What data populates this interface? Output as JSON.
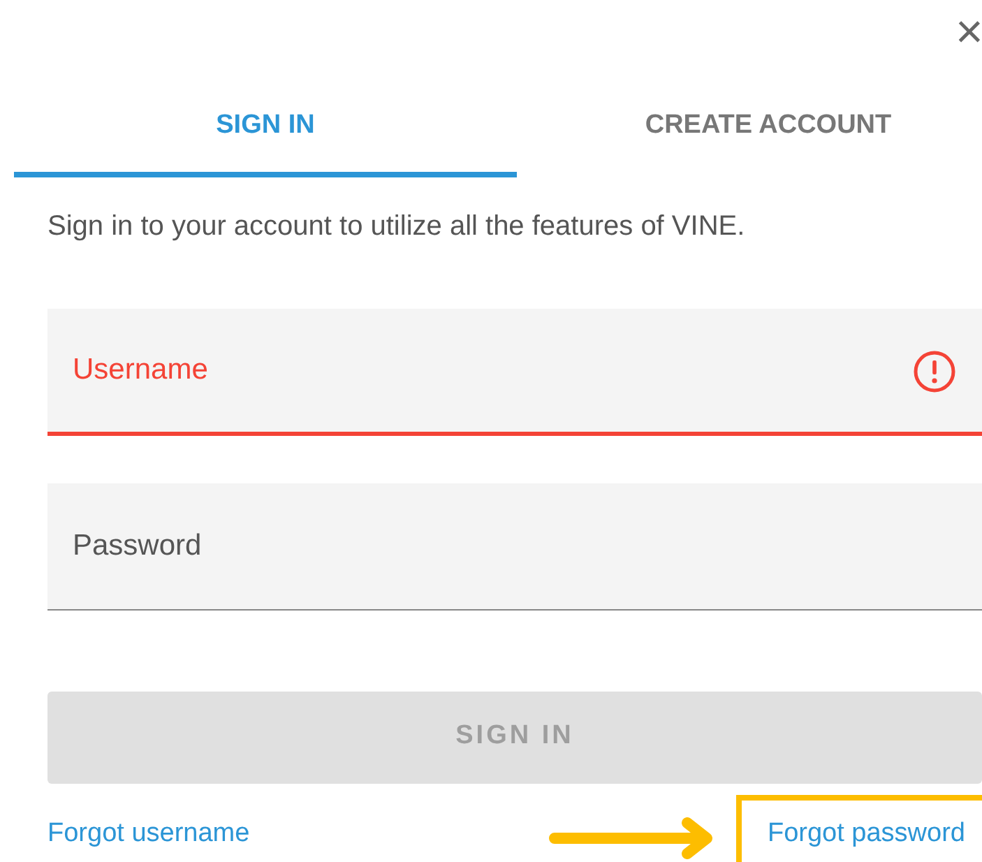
{
  "close": {
    "symbol": "×"
  },
  "tabs": [
    {
      "label": "SIGN IN",
      "selected": true
    },
    {
      "label": "CREATE ACCOUNT",
      "selected": false
    }
  ],
  "intro": "Sign in to your account to utilize all the features of VINE.",
  "fields": [
    {
      "placeholder": "Username",
      "error": true
    },
    {
      "placeholder": "Password",
      "error": false
    }
  ],
  "submit": {
    "label": "SIGN IN",
    "disabled": true
  },
  "links": [
    {
      "label": "Forgot username",
      "highlighted": false
    },
    {
      "label": "Forgot password",
      "highlighted": true
    }
  ]
}
